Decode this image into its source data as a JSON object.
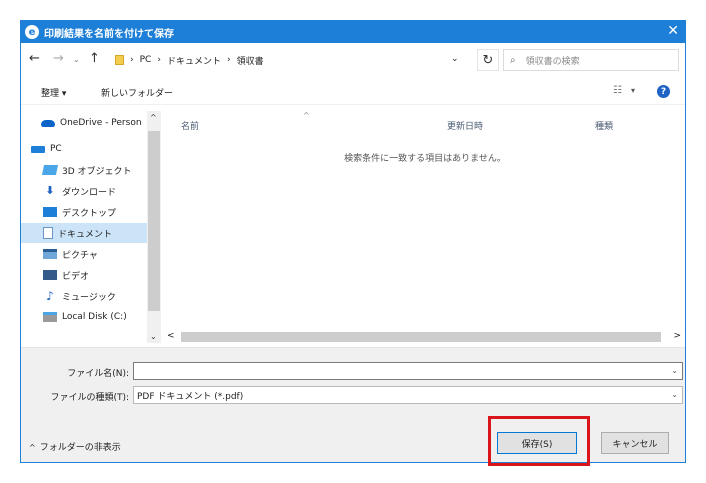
{
  "window": {
    "title": "印刷結果を名前を付けて保存",
    "close_glyph": "✕"
  },
  "address": {
    "back": "←",
    "forward": "→",
    "recent": "⌄",
    "up": "↑",
    "breadcrumbs": [
      "PC",
      "ドキュメント",
      "領収書"
    ],
    "separator": "›",
    "dropdown": "⌄",
    "refresh": "↻",
    "search_placeholder": "領収書の検索"
  },
  "toolbar": {
    "organize": "整理 ▾",
    "new_folder": "新しいフォルダー",
    "view_glyph": "☷",
    "view_drop": "▾",
    "help": "?"
  },
  "nav": {
    "items": [
      {
        "label": "OneDrive - Person",
        "icon": "cloud-icon"
      },
      {
        "label": "PC",
        "icon": "pc-icon"
      },
      {
        "label": "3D オブジェクト",
        "icon": "3d-objects-icon"
      },
      {
        "label": "ダウンロード",
        "icon": "download-icon",
        "glyph": "⬇"
      },
      {
        "label": "デスクトップ",
        "icon": "desktop-icon"
      },
      {
        "label": "ドキュメント",
        "icon": "documents-icon",
        "selected": true
      },
      {
        "label": "ピクチャ",
        "icon": "pictures-icon"
      },
      {
        "label": "ビデオ",
        "icon": "videos-icon"
      },
      {
        "label": "ミュージック",
        "icon": "music-icon",
        "glyph": "♪"
      },
      {
        "label": "Local Disk (C:)",
        "icon": "disk-icon"
      }
    ],
    "scroll_up": "^",
    "scroll_down": "⌄"
  },
  "content": {
    "columns": [
      "名前",
      "更新日時",
      "種類"
    ],
    "sort_caret": "^",
    "empty_message": "検索条件に一致する項目はありません。",
    "hscroll_left": "<",
    "hscroll_right": ">"
  },
  "form": {
    "filename_label": "ファイル名(N):",
    "filename_value": "",
    "filetype_label": "ファイルの種類(T):",
    "filetype_value": "PDF ドキュメント (*.pdf)",
    "drop": "⌄",
    "hide_folders": "フォルダーの非表示",
    "hide_chevron": "^",
    "save_label": "保存(S)",
    "cancel_label": "キャンセル"
  },
  "colors": {
    "accent": "#1e7fd8",
    "highlight": "#d9141b",
    "selection": "#cce4f7"
  }
}
